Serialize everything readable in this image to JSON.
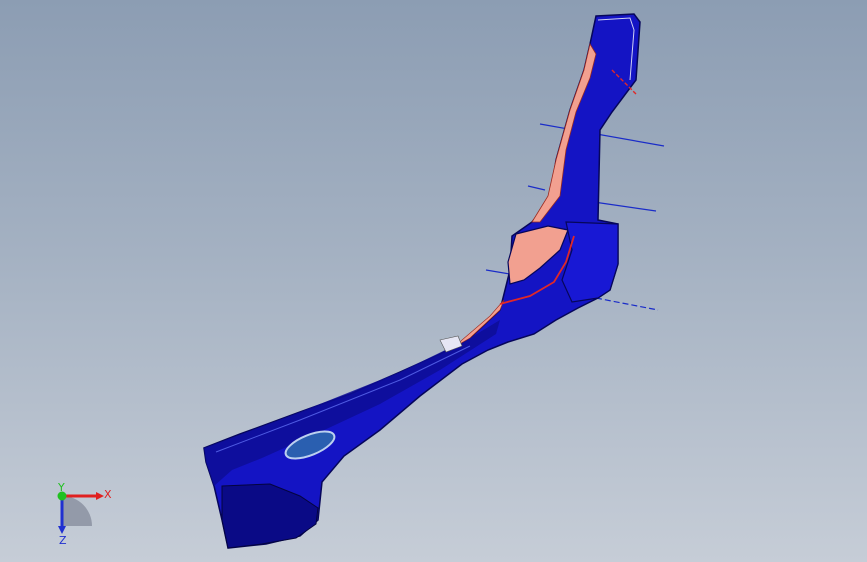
{
  "view": {
    "background_top": "#8c9db3",
    "background_bottom": "#c6cdd7"
  },
  "model": {
    "part_color": "#1212c8",
    "part_dark": "#080878",
    "inner_color": "#f2a090",
    "section_line_color": "#1a2cc8"
  },
  "triad": {
    "x_label": "X",
    "y_label": "Y",
    "z_label": "Z",
    "x_color": "#e02020",
    "y_color": "#20c020",
    "z_color": "#2030d0"
  }
}
